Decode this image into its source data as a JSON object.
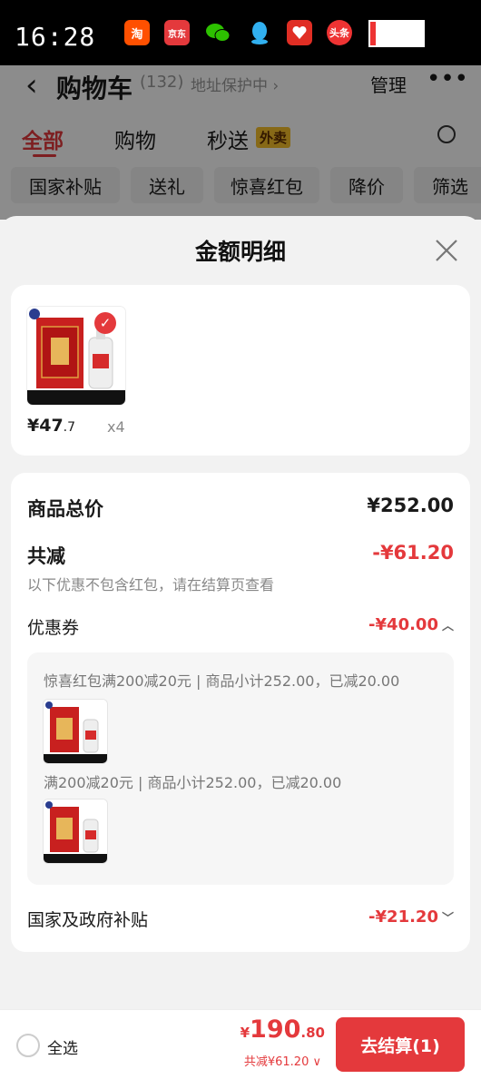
{
  "status_bar": {
    "time": "16:28",
    "apps": [
      {
        "icon": "taobao-icon",
        "label": "淘",
        "color": "#ff5000"
      },
      {
        "icon": "jd-icon",
        "label": "京东",
        "color": "#e4393c"
      },
      {
        "icon": "wechat-icon",
        "label": "",
        "color": "#2dc100"
      },
      {
        "icon": "qq-icon",
        "label": "",
        "color": "#31b0f0"
      },
      {
        "icon": "pinduoduo-icon",
        "label": "",
        "color": "#e02e24"
      },
      {
        "icon": "toutiao-icon",
        "label": "头条",
        "color": "#e33"
      }
    ]
  },
  "background_page": {
    "title": "购物车",
    "count": "(132)",
    "address": "地址保护中 ›",
    "manage": "管理",
    "tabs": [
      "全部",
      "购物",
      "秒送"
    ],
    "tab_badge": "外卖",
    "chips": [
      "国家补贴",
      "送礼",
      "惊喜红包",
      "降价",
      "筛选"
    ]
  },
  "sheet": {
    "title": "金额明细",
    "product": {
      "price_int": "¥47",
      "price_dec": ".7",
      "qty": "x4"
    },
    "total_label": "商品总价",
    "total_value": "¥252.00",
    "discount_label": "共减",
    "discount_value": "-¥61.20",
    "note": "以下优惠不包含红包，请在结算页查看",
    "coupon_label": "优惠券",
    "coupon_value": "-¥40.00",
    "coupon_lines": [
      "惊喜红包满200减20元 | 商品小计252.00，已减20.00",
      "满200减20元 | 商品小计252.00，已减20.00"
    ],
    "subsidy_label": "国家及政府补贴",
    "subsidy_value": "-¥21.20"
  },
  "bottom_bar": {
    "select_all": "全选",
    "currency": "¥",
    "total_int": "190",
    "total_dec": ".80",
    "saved": "共减¥61.20 ∨",
    "checkout": "去结算(1)"
  },
  "colors": {
    "accent": "#e4393c",
    "badge": "#f6c02b"
  }
}
